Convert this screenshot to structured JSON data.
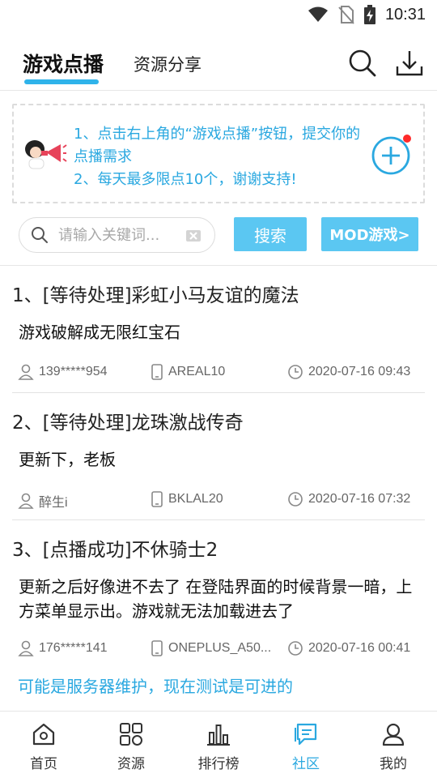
{
  "status_bar": {
    "time": "10:31"
  },
  "header": {
    "tabs": [
      {
        "label": "游戏点播",
        "active": true
      },
      {
        "label": "资源分享",
        "active": false
      }
    ]
  },
  "banner": {
    "line1": "1、点击右上角的“游戏点播”按钮，提交你的点播需求",
    "line2": "2、每天最多限点10个，谢谢支持!"
  },
  "search": {
    "placeholder": "请输入关键词...",
    "button_label": "搜索",
    "mod_button_label": "MOD游戏>"
  },
  "posts": [
    {
      "title": "1、[等待处理]彩虹小马友谊的魔法",
      "body": "游戏破解成无限红宝石",
      "user": "139*****954",
      "device": "AREAL10",
      "time": "2020-07-16 09:43"
    },
    {
      "title": "2、[等待处理]龙珠激战传奇",
      "body": "更新下，老板",
      "user": "醉生i",
      "device": "BKLAL20",
      "time": "2020-07-16 07:32"
    },
    {
      "title": "3、[点播成功]不休骑士2",
      "body": "更新之后好像进不去了 在登陆界面的时候背景一暗，上方菜单显示出。游戏就无法加载进去了",
      "user": "176*****141",
      "device": "ONEPLUS_A50...",
      "time": "2020-07-16 00:41",
      "reply": "可能是服务器维护，现在测试是可进的"
    }
  ],
  "bottom_nav": [
    {
      "label": "首页",
      "icon": "home-icon"
    },
    {
      "label": "资源",
      "icon": "grid-icon"
    },
    {
      "label": "排行榜",
      "icon": "bar-chart-icon"
    },
    {
      "label": "社区",
      "icon": "chat-icon",
      "active": true
    },
    {
      "label": "我的",
      "icon": "person-icon"
    }
  ],
  "colors": {
    "accent": "#2aa8e0",
    "button": "#5bc7f2",
    "badge": "#ff2a2a"
  }
}
